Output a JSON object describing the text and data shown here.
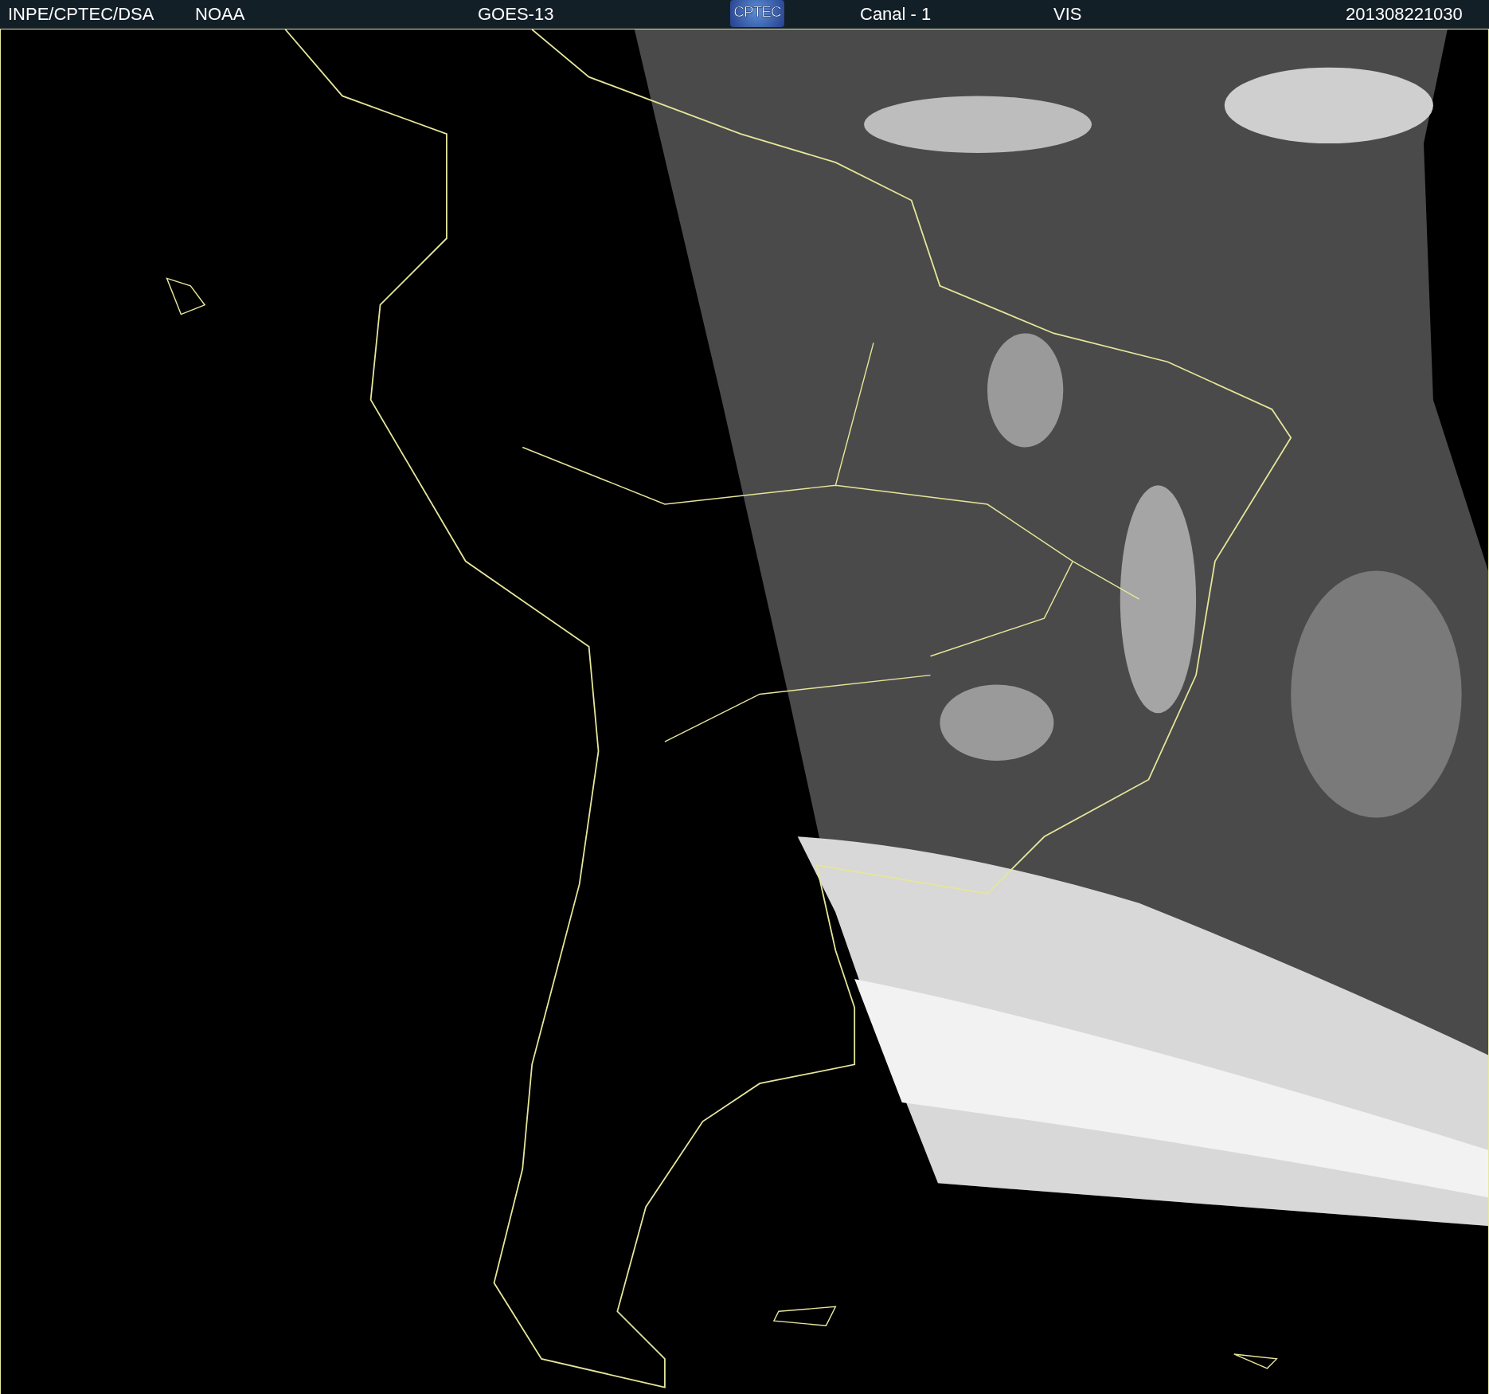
{
  "header": {
    "items": [
      {
        "kind": "text",
        "text": "INPE/CPTEC/DSA"
      },
      {
        "kind": "text",
        "text": "NOAA"
      },
      {
        "kind": "text",
        "text": "GOES-13"
      },
      {
        "kind": "logo",
        "text": "CPTEC"
      },
      {
        "kind": "text",
        "text": "Canal - 1"
      },
      {
        "kind": "text",
        "text": "VIS"
      },
      {
        "kind": "text",
        "text": "201308221030"
      }
    ]
  }
}
